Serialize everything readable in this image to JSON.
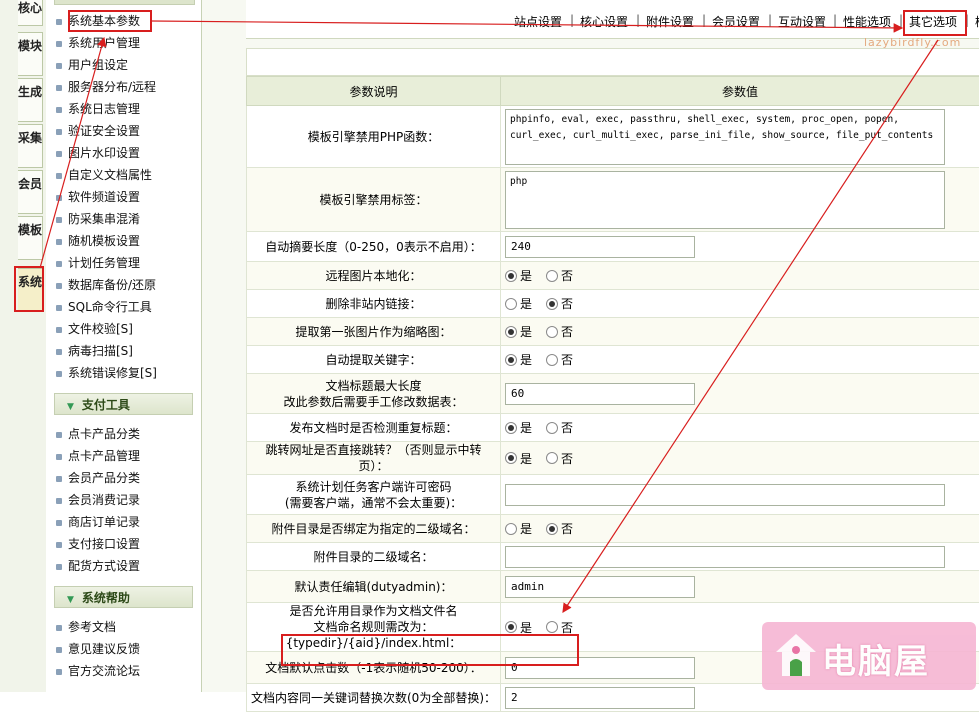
{
  "vtabs": [
    "核心",
    "模块",
    "生成",
    "采集",
    "会员",
    "模板",
    "系统"
  ],
  "menu": {
    "system_items": [
      "系统基本参数",
      "系统用户管理",
      "用户组设定",
      "服务器分布/远程",
      "系统日志管理",
      "验证安全设置",
      "图片水印设置",
      "自定义文档属性",
      "软件频道设置",
      "防采集串混淆",
      "随机模板设置",
      "计划任务管理",
      "数据库备份/还原",
      "SQL命令行工具",
      "文件校验[S]",
      "病毒扫描[S]",
      "系统错误修复[S]"
    ],
    "pay_group_title": "支付工具",
    "pay_items": [
      "点卡产品分类",
      "点卡产品管理",
      "会员产品分类",
      "会员消费记录",
      "商店订单记录",
      "支付接口设置",
      "配货方式设置"
    ],
    "help_group_title": "系统帮助",
    "help_items": [
      "参考文档",
      "意见建议反馈",
      "官方交流论坛"
    ]
  },
  "tabs": [
    "站点设置",
    "核心设置",
    "附件设置",
    "会员设置",
    "互动设置",
    "性能选项",
    "其它选项",
    "模"
  ],
  "watermark": "lazybirdfly.com",
  "table": {
    "header_label": "参数说明",
    "header_value": "参数值",
    "radio_yes": "是",
    "radio_no": "否",
    "rows": [
      {
        "label": "模板引擎禁用PHP函数：",
        "type": "textarea",
        "value": "phpinfo, eval, exec, passthru, shell_exec, system, proc_open, popen, curl_exec, curl_multi_exec, parse_ini_file, show_source, file_put_contents"
      },
      {
        "label": "模板引擎禁用标签：",
        "type": "textarea",
        "value": "php"
      },
      {
        "label": "自动摘要长度（0-250，0表示不启用）：",
        "type": "input",
        "value": "240"
      },
      {
        "label": "远程图片本地化：",
        "type": "radio",
        "value": "是"
      },
      {
        "label": "删除非站内链接：",
        "type": "radio",
        "value": "否"
      },
      {
        "label": "提取第一张图片作为缩略图：",
        "type": "radio",
        "value": "是"
      },
      {
        "label": "自动提取关键字：",
        "type": "radio",
        "value": "是"
      },
      {
        "label": "文档标题最大长度",
        "label2": "改此参数后需要手工修改数据表：",
        "type": "input",
        "value": "60"
      },
      {
        "label": "发布文档时是否检测重复标题：",
        "type": "radio",
        "value": "是"
      },
      {
        "label": "跳转网址是否直接跳转？（否则显示中转页）：",
        "type": "radio",
        "value": "是"
      },
      {
        "label": "系统计划任务客户端许可密码",
        "label2": "(需要客户端，通常不会太重要)：",
        "type": "input_wide",
        "value": ""
      },
      {
        "label": "附件目录是否绑定为指定的二级域名：",
        "type": "radio",
        "value": "否"
      },
      {
        "label": "附件目录的二级域名：",
        "type": "input_wide",
        "value": ""
      },
      {
        "label": "默认责任编辑(dutyadmin)：",
        "type": "input",
        "value": "admin"
      },
      {
        "label": "是否允许用目录作为文档文件名",
        "label2": "文档命名规则需改为：{typedir}/{aid}/index.html：",
        "type": "radio",
        "value": "是"
      },
      {
        "label": "文档默认点击数（-1表示随机50-200）：",
        "type": "input",
        "value": "0"
      },
      {
        "label": "文档内容同一关键词替换次数(0为全部替换)：",
        "type": "input",
        "value": "2"
      }
    ]
  },
  "logo": {
    "text": "电脑屋",
    "icon": "house-icon"
  },
  "colors": {
    "annotation": "#d81e1e",
    "header_bg": "#e8eed9",
    "logo_bg": "#f6b7d4"
  }
}
